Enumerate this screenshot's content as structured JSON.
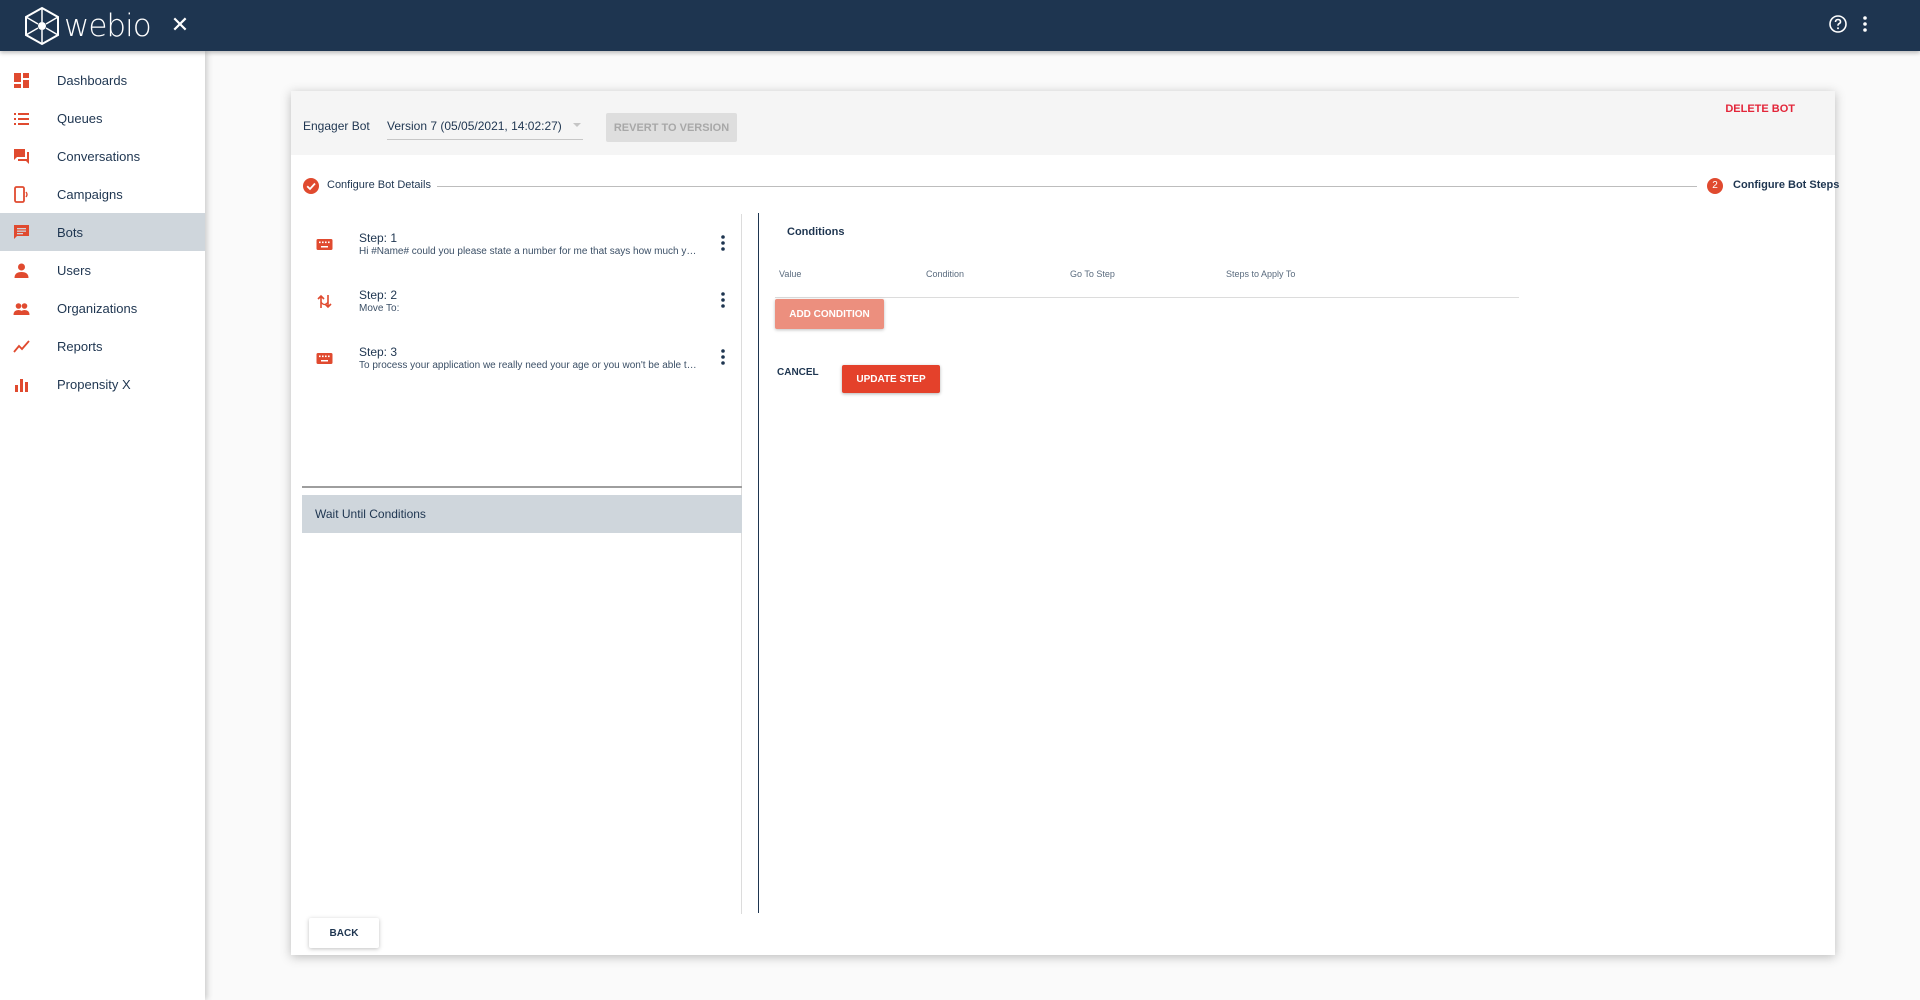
{
  "app": {
    "logo_text": "webio"
  },
  "topbar": {
    "help_icon": "help-circle-icon",
    "menu_icon": "more-vert-icon"
  },
  "sidebar": {
    "items": [
      {
        "label": "Dashboards",
        "icon": "dashboard-icon",
        "active": false
      },
      {
        "label": "Queues",
        "icon": "list-icon",
        "active": false
      },
      {
        "label": "Conversations",
        "icon": "forum-icon",
        "active": false
      },
      {
        "label": "Campaigns",
        "icon": "phone-campaign-icon",
        "active": false
      },
      {
        "label": "Bots",
        "icon": "chat-icon",
        "active": true
      },
      {
        "label": "Users",
        "icon": "person-icon",
        "active": false
      },
      {
        "label": "Organizations",
        "icon": "people-icon",
        "active": false
      },
      {
        "label": "Reports",
        "icon": "trending-up-icon",
        "active": false
      },
      {
        "label": "Propensity X",
        "icon": "bar-chart-icon",
        "active": false
      }
    ]
  },
  "header": {
    "bot_name": "Engager Bot",
    "version": "Version 7 (05/05/2021, 14:02:27)",
    "revert_label": "REVERT TO VERSION",
    "delete_label": "DELETE BOT"
  },
  "stepper": {
    "step1_label": "Configure Bot Details",
    "step2_number": "2",
    "step2_label": "Configure Bot Steps"
  },
  "steps": [
    {
      "title": "Step: 1",
      "desc": "Hi #Name# could you please state a number for me that says how much you would like to borrow",
      "icon": "keyboard-icon"
    },
    {
      "title": "Step: 2",
      "desc": "Move To:",
      "icon": "swap-icon"
    },
    {
      "title": "Step: 3",
      "desc": "To process your application we really need your age or you won't be able to proceed",
      "icon": "keyboard-icon"
    }
  ],
  "wait_until": "Wait Until Conditions",
  "conditions": {
    "title": "Conditions",
    "headers": [
      "Value",
      "Condition",
      "Go To Step",
      "Steps to Apply To"
    ],
    "add_label": "ADD CONDITION",
    "cancel_label": "CANCEL",
    "update_label": "UPDATE STEP"
  },
  "back_label": "BACK",
  "colors": {
    "navy": "#1e3550",
    "accent": "#e4412b",
    "delete": "#e3263a"
  }
}
